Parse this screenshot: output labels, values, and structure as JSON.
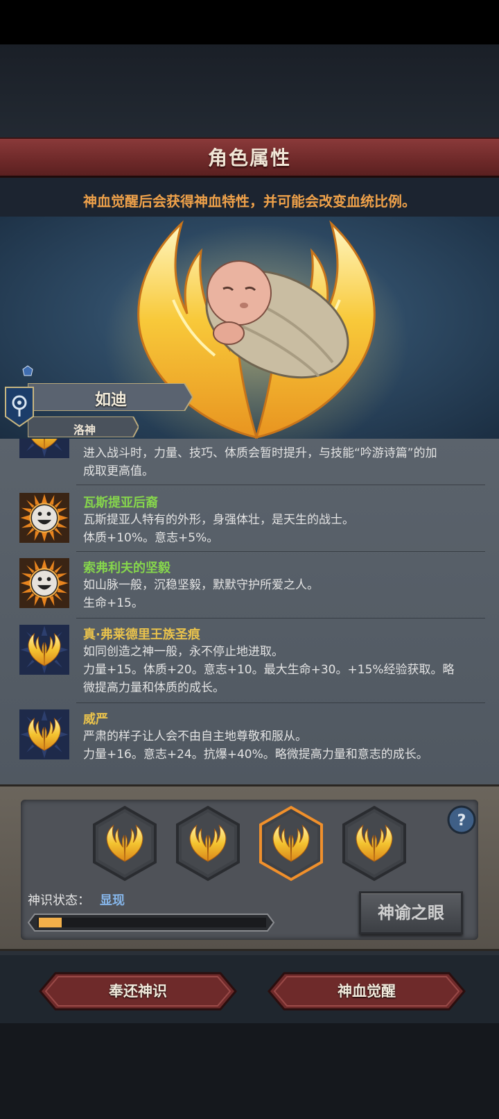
{
  "header": {
    "title": "角色属性",
    "subtitle": "神血觉醒后会获得神血特性，并可能会改变血统比例。"
  },
  "portrait": {
    "icon": "swaddled-baby-with-golden-wings"
  },
  "character": {
    "name": "如迪",
    "god": "洛神",
    "crest_icon": "eye-crest-icon"
  },
  "traits": [
    {
      "name": "",
      "icon": "golden-wings-icon",
      "lines": [
        "进入战斗时，力量、技巧、体质会暂时提升，与技能“吟游诗篇”的加",
        "成取更高值。"
      ]
    },
    {
      "name": "瓦斯提亚后裔",
      "name_color": "#86d64c",
      "icon": "smiley-face-icon",
      "lines": [
        "瓦斯提亚人特有的外形，身强体壮，是天生的战士。",
        "体质+10%。意志+5%。"
      ]
    },
    {
      "name": "索弗利夫的坚毅",
      "name_color": "#86d64c",
      "icon": "smiley-face-icon",
      "lines": [
        "如山脉一般，沉稳坚毅，默默守护所爱之人。",
        "生命+15。"
      ]
    },
    {
      "name": "真·弗莱德里王族圣痕",
      "name_color": "#e9c24c",
      "icon": "golden-wings-icon",
      "lines": [
        "如同创造之神一般，永不停止地进取。",
        "力量+15。体质+20。意志+10。最大生命+30。+15%经验获取。略",
        "微提高力量和体质的成长。"
      ]
    },
    {
      "name": "威严",
      "name_color": "#e9c24c",
      "icon": "golden-wings-icon",
      "lines": [
        "严肃的样子让人会不由自主地尊敬和服从。",
        "力量+16。意志+24。抗爆+40%。略微提高力量和意志的成长。"
      ]
    }
  ],
  "slots": {
    "count": 4,
    "selected_index": 2,
    "icon": "golden-wings-icon"
  },
  "status": {
    "label": "神识状态：",
    "value": "显现",
    "progress": 0.1
  },
  "buttons": {
    "help": "?",
    "oracle_eye": "神谕之眼",
    "return": "奉还神识",
    "awaken": "神血觉醒"
  },
  "colors": {
    "accent_orange": "#f0a24a",
    "banner_red": "#7a3030",
    "trait_green": "#86d64c",
    "trait_gold": "#e9c24c",
    "status_blue": "#86b6ea"
  }
}
